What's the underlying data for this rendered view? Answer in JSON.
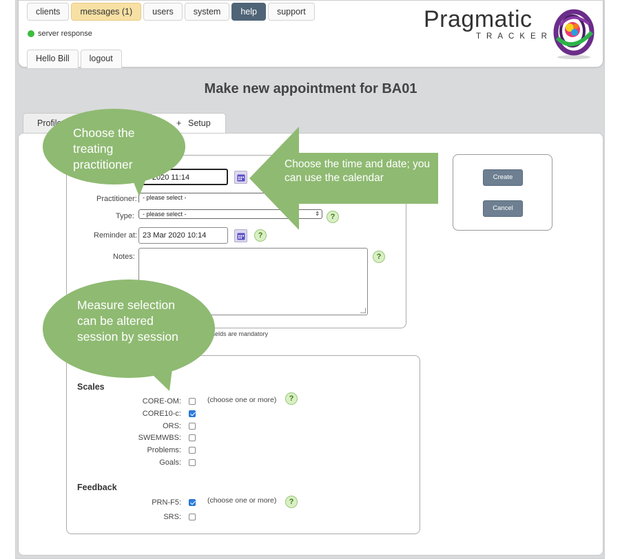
{
  "nav": {
    "tabs": [
      {
        "label": "clients"
      },
      {
        "label": "messages (1)"
      },
      {
        "label": "users"
      },
      {
        "label": "system"
      },
      {
        "label": "help"
      },
      {
        "label": "support"
      }
    ],
    "status": "server response",
    "user_tabs": [
      {
        "label": "Hello Bill"
      },
      {
        "label": "logout"
      }
    ]
  },
  "logo": {
    "title": "Pragmatic",
    "subtitle": "TRACKER"
  },
  "page": {
    "title": "Make new appointment for BA01",
    "tabs": [
      {
        "label": "Profile"
      },
      {
        "label": "Setup"
      }
    ],
    "setup_prefix": "+"
  },
  "form": {
    "datetime_value": "ar 2020 11:14",
    "practitioner_label": "Practitioner:",
    "practitioner_value": "- please select -",
    "type_label": "Type:",
    "type_value": "- please select -",
    "reminder_label": "Reminder at:",
    "reminder_value": "23 Mar 2020 10:14",
    "notes_label": "Notes:",
    "mandatory_note": "d fields are mandatory",
    "help_glyph": "?"
  },
  "actions": {
    "create": "Create",
    "cancel": "Cancel"
  },
  "measures": {
    "scales_title": "Scales",
    "scales": [
      {
        "label": "CORE-OM:",
        "checked": false
      },
      {
        "label": "CORE10-c:",
        "checked": true
      },
      {
        "label": "ORS:",
        "checked": false
      },
      {
        "label": "SWEMWBS:",
        "checked": false
      },
      {
        "label": "Problems:",
        "checked": false
      },
      {
        "label": "Goals:",
        "checked": false
      }
    ],
    "scales_hint": "(choose one or more)",
    "feedback_title": "Feedback",
    "feedback": [
      {
        "label": "PRN-F5:",
        "checked": true
      },
      {
        "label": "SRS:",
        "checked": false
      }
    ],
    "feedback_hint": "(choose one or more)"
  },
  "annotations": {
    "practitioner": "Choose the treating practitioner",
    "datetime": "Choose the time and date; you can use the calendar",
    "measures": "Measure selection can be altered session by session"
  },
  "colors": {
    "callout_green": "#8fba72",
    "nav_active": "#4f6477",
    "messages_tab": "#f7e0a3",
    "status_ok": "#3fbc3f",
    "button": "#6d7f91"
  }
}
